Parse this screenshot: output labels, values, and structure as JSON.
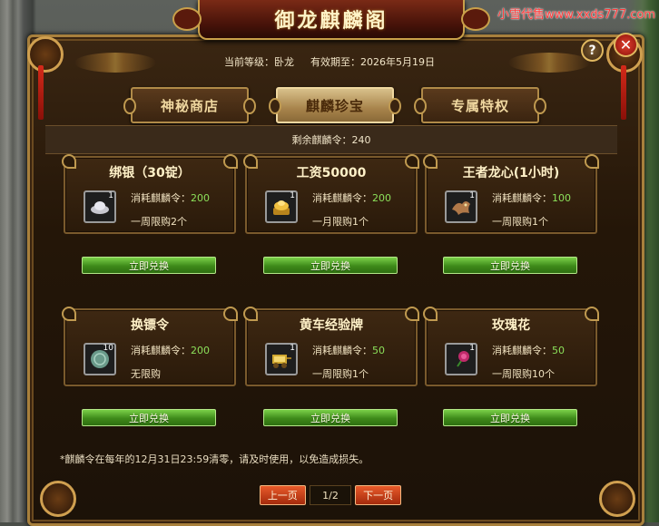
{
  "watermark": "小雪代售www.xxds777.com",
  "window": {
    "title": "御龙麒麟阁",
    "help_label": "?",
    "close_label": "✕"
  },
  "info": {
    "level_label": "当前等级：卧龙",
    "expiry_label": "有效期至：2026年5月19日"
  },
  "tabs": [
    {
      "label": "神秘商店",
      "active": false
    },
    {
      "label": "麒麟珍宝",
      "active": true
    },
    {
      "label": "专属特权",
      "active": false
    }
  ],
  "remaining": "剩余麒麟令：240",
  "cost_prefix": "消耗麒麟令：",
  "redeem_label": "立即兑换",
  "items": [
    {
      "title": "绑银（30锭）",
      "icon": "silver-ingot-icon",
      "count": "1",
      "cost": "200",
      "limit": "一周限购2个",
      "icon_color": "#c8c8d0"
    },
    {
      "title": "工资50000",
      "icon": "gold-ingot-icon",
      "count": "1",
      "cost": "200",
      "limit": "一月限购1个",
      "icon_color": "#e0b030"
    },
    {
      "title": "王者龙心(1小时)",
      "icon": "dragon-heart-icon",
      "count": "1",
      "cost": "100",
      "limit": "一周限购1个",
      "icon_color": "#b07848"
    },
    {
      "title": "换镖令",
      "icon": "escort-token-icon",
      "count": "10",
      "cost": "200",
      "limit": "无限购",
      "icon_color": "#6a9a8a"
    },
    {
      "title": "黄车经验牌",
      "icon": "yellow-cart-exp-icon",
      "count": "1",
      "cost": "50",
      "limit": "一周限购1个",
      "icon_color": "#d0a830"
    },
    {
      "title": "玫瑰花",
      "icon": "rose-icon",
      "count": "1",
      "cost": "50",
      "limit": "一周限购10个",
      "icon_color": "#c02a6a"
    }
  ],
  "notice": "*麒麟令在每年的12月31日23:59清零，请及时使用，以免造成损失。",
  "pager": {
    "prev_label": "上一页",
    "page": "1/2",
    "next_label": "下一页"
  },
  "colors": {
    "cost_green": "#8ce05a",
    "button_green": "#3e8a1a",
    "frame_gold": "#a8803c"
  }
}
